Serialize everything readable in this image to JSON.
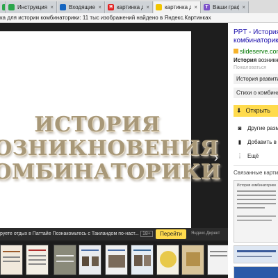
{
  "tabs": [
    {
      "label": "",
      "color": "#2aa64a"
    },
    {
      "label": "Инструкция по",
      "color": "#2aa64a"
    },
    {
      "label": "Входящие - По",
      "color": "#1565c0"
    },
    {
      "label": "картинка для",
      "color": "#e02020"
    },
    {
      "label": "картинка для",
      "color": "#f2c500"
    },
    {
      "label": "Ваши графики",
      "color": "#7b4fc9"
    }
  ],
  "title_bar": "ка для истории комбинаторики: 11 тыс изображений найдено в Яндекс.Картинках",
  "slide": {
    "title_lines": [
      "ИСТОРИЯ",
      "ВОЗНИКНОВЕНИЯ",
      "КОМБИНАТОРИКИ"
    ]
  },
  "ad": {
    "text": "руете отдых в Паттайе  Познакомьтесь с Таиландом по-наст...",
    "age": "18+",
    "button": "Перейти",
    "source": "Яндекс.Директ"
  },
  "panel": {
    "title_line1": "PPT - История",
    "title_line2": "комбинаторики",
    "site": "slideserve.com",
    "desc_bold": "История",
    "desc_rest": " возникно",
    "complain": "Пожаловаться",
    "pill1": "История развития",
    "pill2": "Стихи о комбинато",
    "open": "Открыть",
    "actions": [
      {
        "label": "Другие разм",
        "icon": "camera-icon"
      },
      {
        "label": "Добавить в ко",
        "icon": "bookmark-icon"
      },
      {
        "label": "Ещё",
        "icon": "more-icon"
      }
    ],
    "related_label": "Связанные картин",
    "related_thumb_title": "История комбинаторики"
  },
  "colors": {
    "accent": "#ffdb4d",
    "link": "#1a0dab",
    "site": "#007700"
  }
}
